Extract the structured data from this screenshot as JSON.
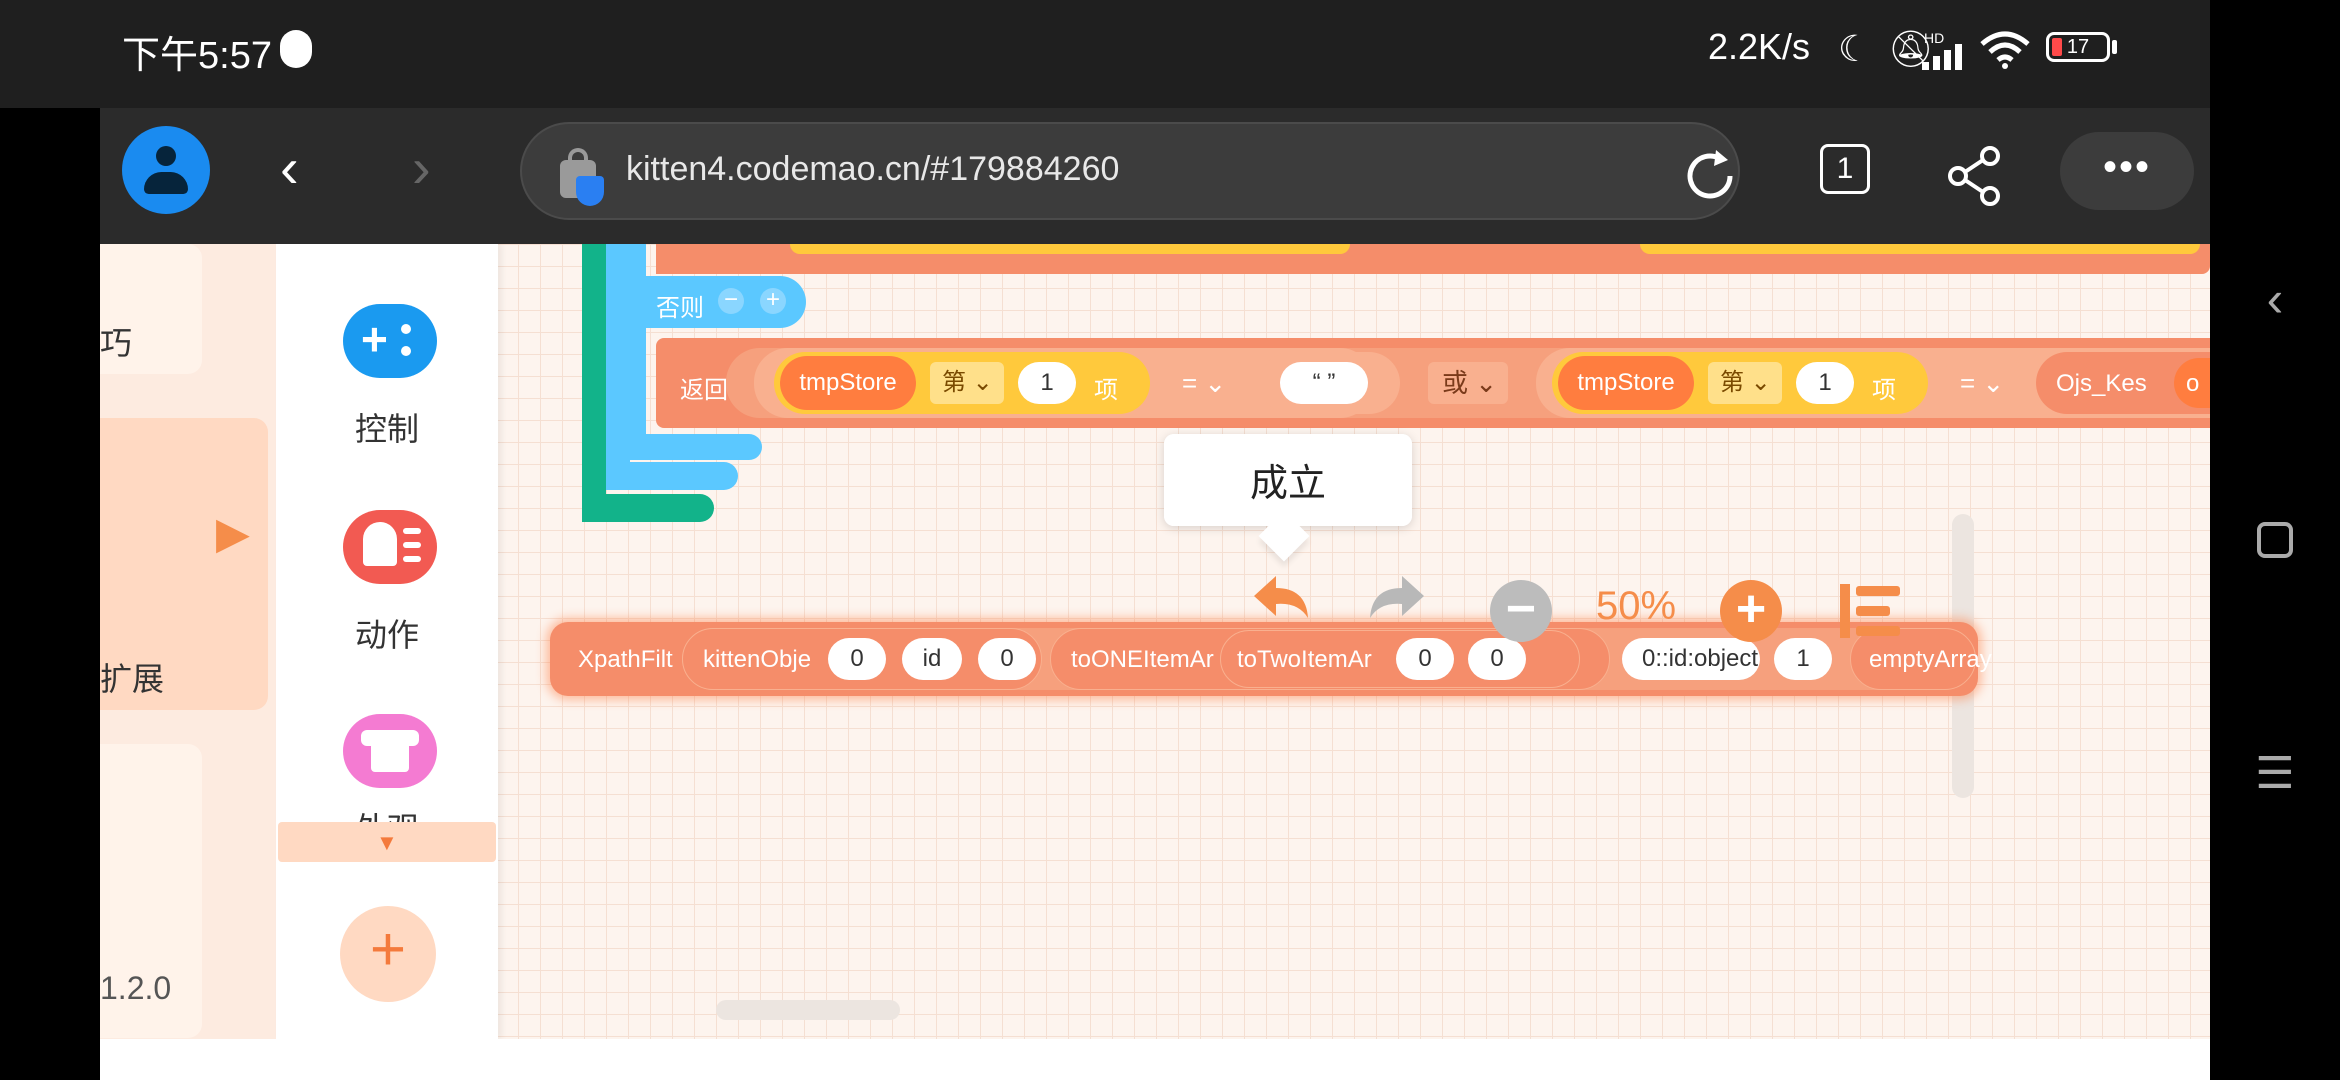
{
  "status_bar": {
    "time": "下午5:57",
    "net_speed": "2.2K/s",
    "battery": "17",
    "signal_label": "HD"
  },
  "browser": {
    "url": "kitten4.codemao.cn/#179884260",
    "tab_count": "1",
    "more": "•••"
  },
  "categories": {
    "items": [
      {
        "label": "巧"
      },
      {
        "label": "扩展"
      },
      {
        "label": "1.2.0"
      }
    ]
  },
  "palette": {
    "items": [
      {
        "label": "控制",
        "color": "#1a9af0"
      },
      {
        "label": "动作",
        "color": "#f25a52"
      },
      {
        "label": "外观",
        "color": "#f47bd2"
      }
    ],
    "add": "+"
  },
  "blocks": {
    "else_label": "否则",
    "return_label": "返回",
    "tmpstore_a": "tmpStore",
    "nth": "第",
    "index": "1",
    "item": "项",
    "eq": "=",
    "empty_str": "“ ”",
    "or": "或",
    "tmpstore_b": "tmpStore",
    "ojs": "Ojs_Kes",
    "ojs_tail": "o",
    "tooltip": "成立",
    "floating": {
      "xpath": "XpathFilt",
      "kitten_obj": "kittenObje",
      "v0a": "0",
      "id": "id",
      "v0b": "0",
      "to_one": "toONEItemAr",
      "to_two": "toTwoItemAr",
      "v0c": "0",
      "v0d": "0",
      "id_obj": "0::id:object",
      "v1": "1",
      "empty_array": "emptyArray"
    }
  },
  "zoom": {
    "level": "50%"
  },
  "colors": {
    "accent": "#f58d4a",
    "block_orange": "#f58d6a",
    "block_green": "#12b38a",
    "block_blue": "#5bc8ff",
    "block_yellow": "#ffc93c"
  }
}
